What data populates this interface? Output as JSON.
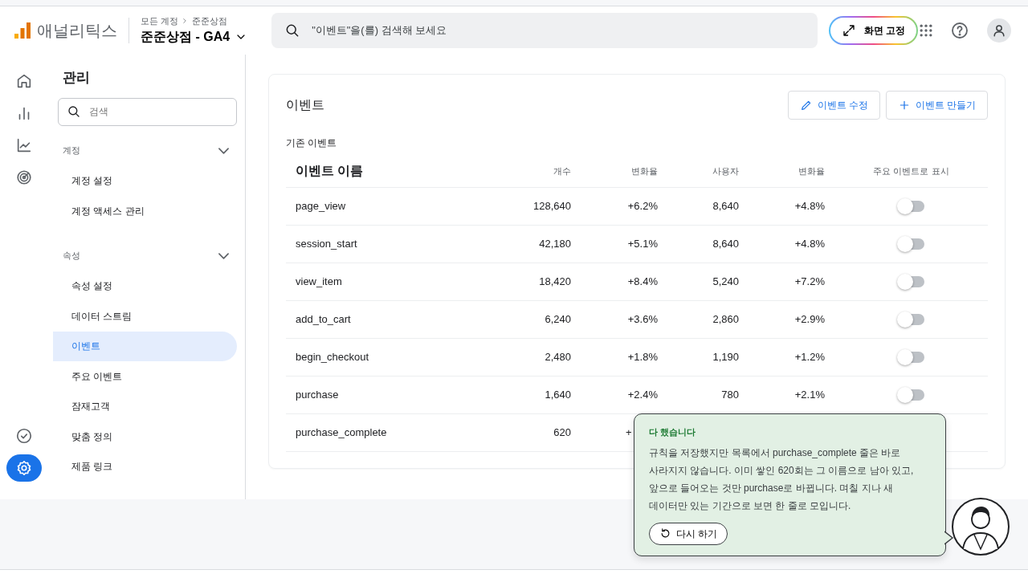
{
  "header": {
    "product": "애널리틱스",
    "breadcrumb": [
      "모든 계정",
      "준준상점"
    ],
    "property": "준준상점 - GA4",
    "search": {
      "placeholder": "\"이벤트\"을(를) 검색해 보세요"
    },
    "pin_button": "화면 고정"
  },
  "rail_items": [
    {
      "kind": "home",
      "selected": false
    },
    {
      "kind": "reports",
      "selected": false
    },
    {
      "kind": "explore",
      "selected": false
    },
    {
      "kind": "advertising",
      "selected": false
    },
    {
      "kind": "check",
      "selected": false
    },
    {
      "kind": "admin",
      "selected": true
    }
  ],
  "sidebar": {
    "title": "관리",
    "search": {
      "placeholder": "검색"
    },
    "sections": [
      {
        "label": "계정",
        "expanded": true,
        "items": [
          {
            "label": "계정 설정",
            "selected": false
          },
          {
            "label": "계정 액세스 관리",
            "selected": false
          }
        ]
      },
      {
        "label": "속성",
        "expanded": true,
        "items": [
          {
            "label": "속성 설정",
            "selected": false
          },
          {
            "label": "데이터 스트림",
            "selected": false
          },
          {
            "label": "이벤트",
            "selected": true
          },
          {
            "label": "주요 이벤트",
            "selected": false
          },
          {
            "label": "잠재고객",
            "selected": false
          },
          {
            "label": "맞춤 정의",
            "selected": false
          },
          {
            "label": "제품 링크",
            "selected": false
          }
        ]
      }
    ]
  },
  "card": {
    "title": "이벤트",
    "buttons": [
      {
        "kind": "edit",
        "label": "이벤트 수정"
      },
      {
        "kind": "create",
        "label": "이벤트 만들기"
      }
    ],
    "subtitle": "기존 이벤트",
    "table": {
      "columns": [
        "이벤트 이름",
        "개수",
        "변화율",
        "사용자",
        "변화율",
        "주요 이벤트로 표시"
      ],
      "rows": [
        {
          "name": "page_view",
          "count": "128,640",
          "change": "+6.2%",
          "users": "8,640",
          "users_change": "+4.8%",
          "key_event": false
        },
        {
          "name": "session_start",
          "count": "42,180",
          "change": "+5.1%",
          "users": "8,640",
          "users_change": "+4.8%",
          "key_event": false
        },
        {
          "name": "view_item",
          "count": "18,420",
          "change": "+8.4%",
          "users": "5,240",
          "users_change": "+7.2%",
          "key_event": false
        },
        {
          "name": "add_to_cart",
          "count": "6,240",
          "change": "+3.6%",
          "users": "2,860",
          "users_change": "+2.9%",
          "key_event": false
        },
        {
          "name": "begin_checkout",
          "count": "2,480",
          "change": "+1.8%",
          "users": "1,190",
          "users_change": "+1.2%",
          "key_event": false
        },
        {
          "name": "purchase",
          "count": "1,640",
          "change": "+2.4%",
          "users": "780",
          "users_change": "+2.1%",
          "key_event": false
        },
        {
          "name": "purchase_complete",
          "count": "620",
          "change": "+"
        }
      ]
    }
  },
  "assistant": {
    "title": "다 했습니다",
    "message": "규칙을 저장했지만 목록에서 purchase_complete 줄은 바로 사라지지 않습니다. 이미 쌓인 620회는 그 이름으로 남아 있고, 앞으로 들어오는 것만 purchase로 바뀝니다. 며칠 지나 새 데이터만 있는 기간으로 보면 한 줄로 모입니다.",
    "button": "다시 하기"
  }
}
